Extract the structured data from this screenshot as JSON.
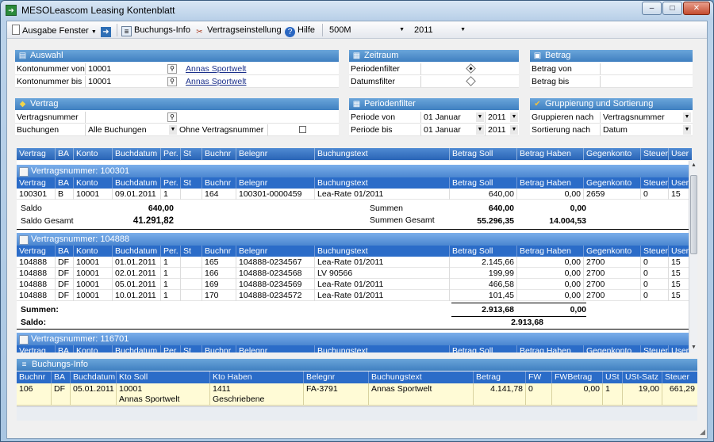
{
  "window": {
    "title": "MESOLeascom Leasing Kontenblatt",
    "min": "–",
    "max": "□",
    "close": "✕"
  },
  "toolbar": {
    "ausgabe": "Ausgabe Fenster",
    "buchungs_info": "Buchungs-Info",
    "vertragseinstellung": "Vertragseinstellung",
    "hilfe": "Hilfe",
    "combo1": "500M",
    "combo2": "2011"
  },
  "auswahl": {
    "title": "Auswahl",
    "rows": [
      {
        "label": "Kontonummer von",
        "value": "10001",
        "link": "Annas Sportwelt"
      },
      {
        "label": "Kontonummer bis",
        "value": "10001",
        "link": "Annas Sportwelt"
      }
    ]
  },
  "zeitraum": {
    "title": "Zeitraum",
    "periodenfilter": "Periodenfilter",
    "datumsfilter": "Datumsfilter"
  },
  "betrag": {
    "title": "Betrag",
    "von": "Betrag von",
    "bis": "Betrag bis"
  },
  "vertrag": {
    "title": "Vertrag",
    "vertragsnummer_label": "Vertragsnummer",
    "buchungen_label": "Buchungen",
    "buchungen_value": "Alle Buchungen",
    "ohne_label": "Ohne Vertragsnummer"
  },
  "periodenfilter": {
    "title": "Periodenfilter",
    "von_label": "Periode von",
    "von_month": "01 Januar",
    "von_year": "2011",
    "bis_label": "Periode bis",
    "bis_month": "01 Januar",
    "bis_year": "2011"
  },
  "gruppierung": {
    "title": "Gruppierung und Sortierung",
    "gruppieren_label": "Gruppieren nach",
    "gruppieren_value": "Vertragsnummer",
    "sortierung_label": "Sortierung nach",
    "sortierung_value": "Datum"
  },
  "columns": [
    "Vertrag",
    "BA",
    "Konto",
    "Buchdatum",
    "Per.",
    "St",
    "Buchnr",
    "Belegnr",
    "Buchungstext",
    "Betrag Soll",
    "Betrag Haben",
    "Gegenkonto",
    "Steuer",
    "User"
  ],
  "groups": [
    {
      "title": "Vertragsnummer: 100301",
      "rows": [
        [
          "100301",
          "B",
          "10001",
          "09.01.2011",
          "1",
          "",
          "164",
          "100301-0000459",
          "Lea-Rate 01/2011",
          "640,00",
          "0,00",
          "2659",
          "0",
          "15"
        ]
      ],
      "saldo_label": "Saldo",
      "saldo": "640,00",
      "saldo_gesamt_label": "Saldo Gesamt",
      "saldo_gesamt": "41.291,82",
      "summen_label": "Summen",
      "summen_soll": "640,00",
      "summen_haben": "0,00",
      "summen_gesamt_label": "Summen Gesamt",
      "summen_gesamt_soll": "55.296,35",
      "summen_gesamt_haben": "14.004,53"
    },
    {
      "title": "Vertragsnummer: 104888",
      "rows": [
        [
          "104888",
          "DF",
          "10001",
          "01.01.2011",
          "1",
          "",
          "165",
          "104888-0234567",
          "Lea-Rate 01/2011",
          "2.145,66",
          "0,00",
          "2700",
          "0",
          "15"
        ],
        [
          "104888",
          "DF",
          "10001",
          "02.01.2011",
          "1",
          "",
          "166",
          "104888-0234568",
          "LV 90566",
          "199,99",
          "0,00",
          "2700",
          "0",
          "15"
        ],
        [
          "104888",
          "DF",
          "10001",
          "05.01.2011",
          "1",
          "",
          "169",
          "104888-0234569",
          "Lea-Rate 01/2011",
          "466,58",
          "0,00",
          "2700",
          "0",
          "15"
        ],
        [
          "104888",
          "DF",
          "10001",
          "10.01.2011",
          "1",
          "",
          "170",
          "104888-0234572",
          "Lea-Rate 01/2011",
          "101,45",
          "0,00",
          "2700",
          "0",
          "15"
        ]
      ],
      "summen_label": "Summen:",
      "summen_soll": "2.913,68",
      "summen_haben": "0,00",
      "saldo_label": "Saldo:",
      "saldo": "2.913,68"
    },
    {
      "title": "Vertragsnummer: 116701"
    }
  ],
  "buchungs_info": {
    "title": "Buchungs-Info",
    "columns": [
      "Buchnr",
      "BA",
      "Buchdatum",
      "Kto Soll",
      "Kto Haben",
      "Belegnr",
      "Buchungstext",
      "Betrag",
      "FW",
      "FWBetrag",
      "USt",
      "USt-Satz",
      "Steuer"
    ],
    "row": {
      "buchnr": "106",
      "ba": "DF",
      "buchdatum": "05.01.2011",
      "kto_soll": "10001",
      "kto_soll_name": "Annas Sportwelt",
      "kto_haben": "1411",
      "kto_haben_name": "Geschriebene",
      "belegnr": "FA-3791",
      "buchungstext": "Annas Sportwelt",
      "betrag": "4.141,78",
      "fw": "0",
      "fwbetrag": "0,00",
      "ust": "1",
      "ust_satz": "19,00",
      "steuer": "661,29"
    }
  }
}
